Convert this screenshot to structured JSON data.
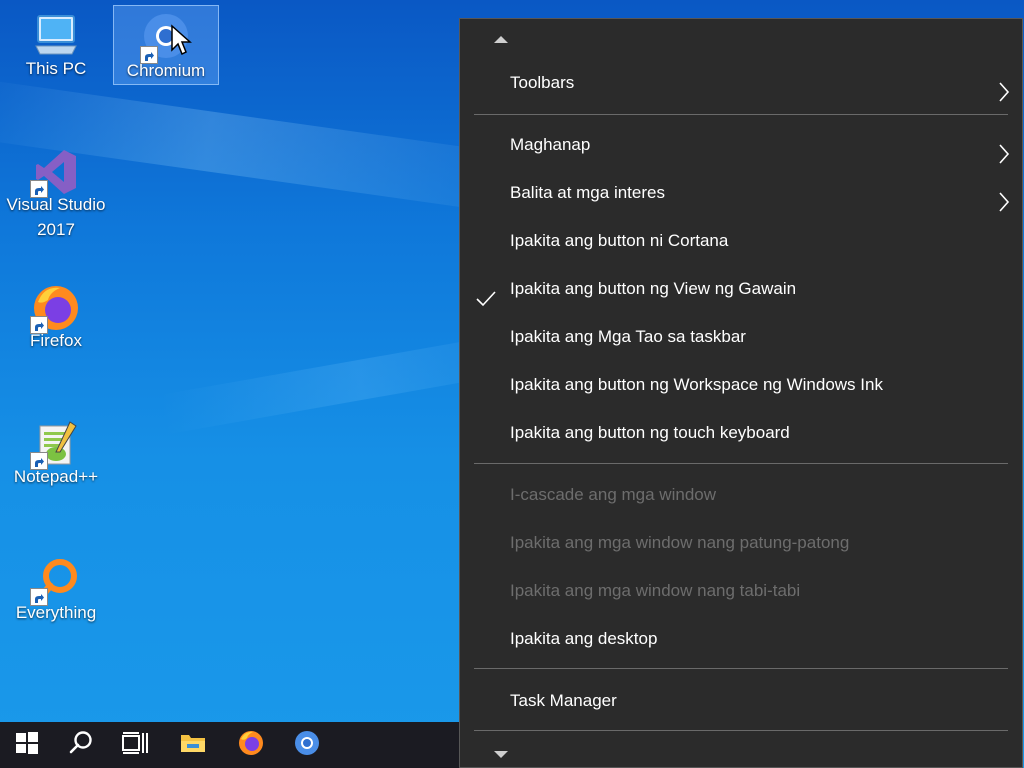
{
  "desktop": {
    "icons": [
      {
        "label": "This PC",
        "icon": "computer-icon"
      },
      {
        "label": "Chromium",
        "icon": "chromium-icon"
      },
      {
        "label_line1": "Visual Studio",
        "label_line2": "2017",
        "icon": "visual-studio-icon"
      },
      {
        "label": "Firefox",
        "icon": "firefox-icon"
      },
      {
        "label": "Notepad++",
        "icon": "notepad-plus-plus-icon"
      },
      {
        "label": "Everything",
        "icon": "everything-icon"
      }
    ]
  },
  "taskbar": {
    "buttons": [
      "windows-start-icon",
      "search-icon",
      "task-view-icon",
      "file-explorer-icon",
      "firefox-icon",
      "chromium-icon"
    ]
  },
  "context_menu": {
    "items": [
      {
        "label": "Toolbars",
        "submenu": true
      },
      {
        "label": "Maghanap",
        "submenu": true
      },
      {
        "label": "Balita at mga interes",
        "submenu": true
      },
      {
        "label": "Ipakita ang button ni Cortana"
      },
      {
        "label": "Ipakita ang button ng View ng Gawain",
        "checked": true
      },
      {
        "label": "Ipakita ang Mga Tao sa taskbar"
      },
      {
        "label": "Ipakita ang button ng Workspace ng Windows Ink"
      },
      {
        "label": "Ipakita ang button ng touch keyboard"
      },
      {
        "label": "I-cascade ang mga window",
        "disabled": true
      },
      {
        "label": "Ipakita ang mga window nang patung-patong",
        "disabled": true
      },
      {
        "label": "Ipakita ang mga window nang tabi-tabi",
        "disabled": true
      },
      {
        "label": "Ipakita ang desktop"
      },
      {
        "label": "Task Manager"
      }
    ]
  },
  "colors": {
    "menu_bg": "#2b2b2b",
    "taskbar_bg": "#1b1b22",
    "disabled_text": "#6d6d6d"
  }
}
